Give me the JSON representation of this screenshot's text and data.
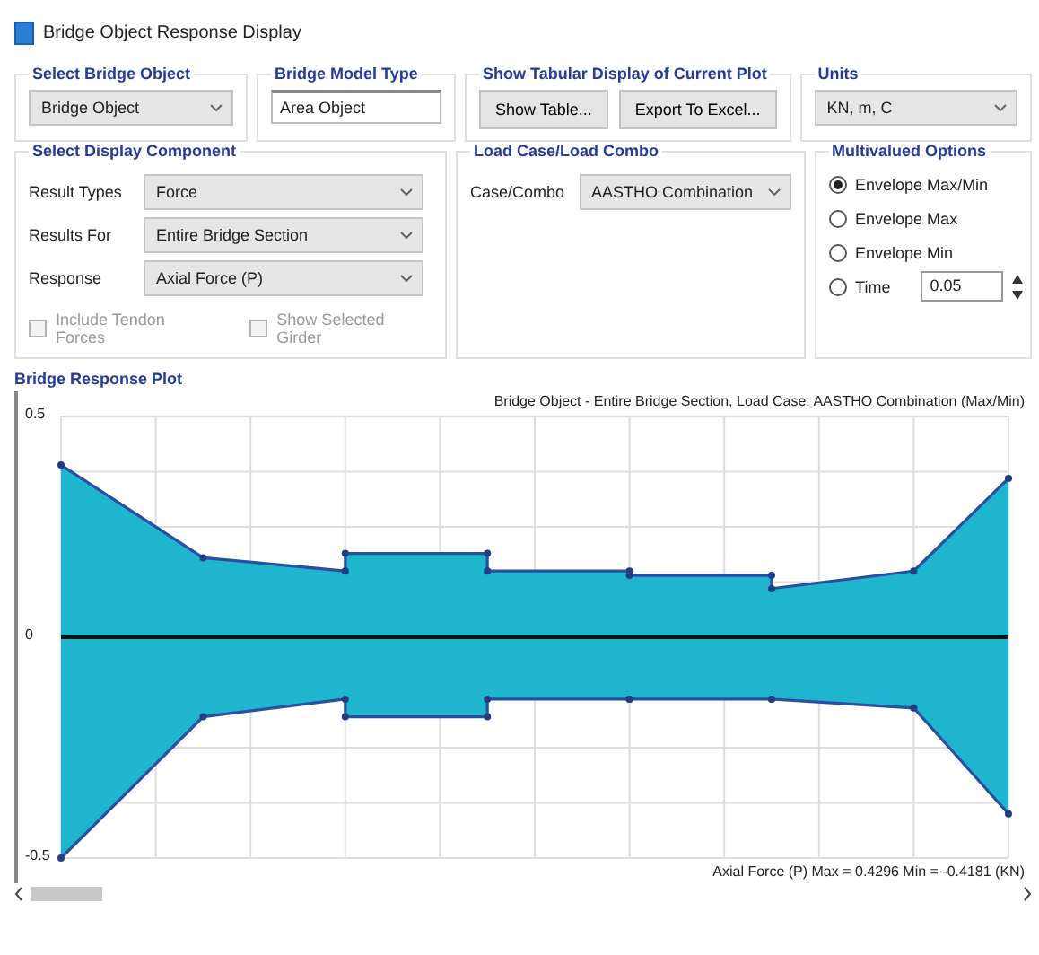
{
  "window": {
    "title": "Bridge Object Response Display"
  },
  "select_bridge_object": {
    "title": "Select Bridge Object",
    "value": "Bridge Object"
  },
  "bridge_model_type": {
    "title": "Bridge Model Type",
    "value": "Area Object"
  },
  "tabular_display": {
    "title": "Show Tabular Display of Current Plot",
    "buttons": [
      "Show Table...",
      "Export To Excel..."
    ]
  },
  "units": {
    "title": "Units",
    "value": "KN, m, C"
  },
  "display_component": {
    "title": "Select Display Component",
    "fields": [
      {
        "label": "Result Types",
        "value": "Force"
      },
      {
        "label": "Results For",
        "value": "Entire Bridge Section"
      },
      {
        "label": "Response",
        "value": "Axial Force  (P)"
      }
    ],
    "checkboxes": [
      {
        "label": "Include Tendon Forces",
        "checked": false,
        "disabled": true
      },
      {
        "label": "Show Selected Girder",
        "checked": false,
        "disabled": true
      }
    ]
  },
  "load_case": {
    "title": "Load Case/Load Combo",
    "label": "Case/Combo",
    "value": "AASTHO Combination"
  },
  "multivalued_options": {
    "title": "Multivalued Options",
    "options": [
      {
        "label": "Envelope Max/Min",
        "selected": true
      },
      {
        "label": "Envelope Max",
        "selected": false
      },
      {
        "label": "Envelope Min",
        "selected": false
      },
      {
        "label": "Time",
        "selected": false
      }
    ],
    "time_value": "0.05"
  },
  "plot": {
    "title": "Bridge Response Plot",
    "header": "Bridge Object - Entire Bridge Section,  Load Case: AASTHO Combination (Max/Min)",
    "y_axis_labels": [
      "0.5",
      "0",
      "-0.5"
    ],
    "footer": "Axial Force  (P)   Max = 0.4296    Min = -0.4181  (KN)"
  }
}
